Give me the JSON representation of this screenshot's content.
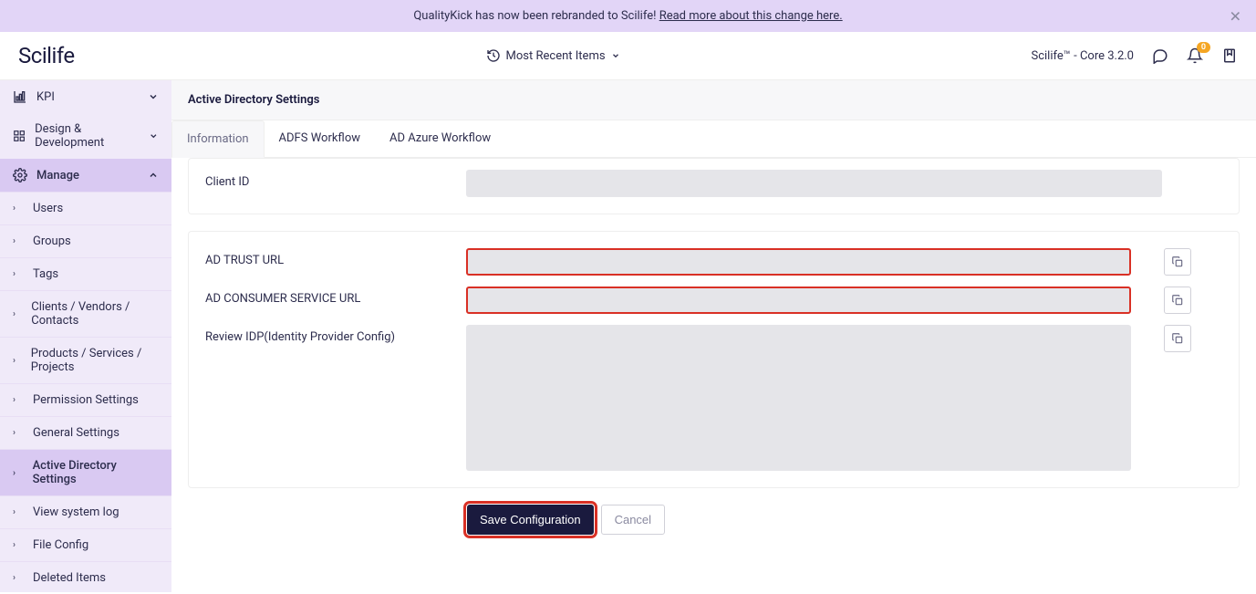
{
  "banner": {
    "text_pre": "QualityKick has now been rebranded to Scilife! ",
    "link_text": "Read more about this change here."
  },
  "header": {
    "logo": "Scilife",
    "recent_items": "Most Recent Items",
    "version": "Scilife™ - Core 3.2.0",
    "notif_badge": "0"
  },
  "sidebar": {
    "top": [
      {
        "label": "KPI",
        "icon": "chart"
      },
      {
        "label": "Design & Development",
        "icon": "grid"
      },
      {
        "label": "Manage",
        "icon": "gear",
        "active": true,
        "open": true
      }
    ],
    "sub": [
      {
        "label": "Users"
      },
      {
        "label": "Groups"
      },
      {
        "label": "Tags"
      },
      {
        "label": "Clients / Vendors / Contacts"
      },
      {
        "label": "Products / Services / Projects"
      },
      {
        "label": "Permission Settings"
      },
      {
        "label": "General Settings"
      },
      {
        "label": "Active Directory Settings",
        "active": true
      },
      {
        "label": "View system log"
      },
      {
        "label": "File Config"
      },
      {
        "label": "Deleted Items"
      }
    ]
  },
  "page": {
    "title": "Active Directory Settings"
  },
  "tabs": [
    {
      "label": "Information",
      "active": true
    },
    {
      "label": "ADFS Workflow"
    },
    {
      "label": "AD Azure Workflow"
    }
  ],
  "fields": {
    "client_id_label": "Client ID",
    "client_id_value": "",
    "ad_trust_label": "AD TRUST URL",
    "ad_trust_value": "",
    "ad_consumer_label": "AD CONSUMER SERVICE URL",
    "ad_consumer_value": "",
    "review_idp_label": "Review IDP(Identity Provider Config)",
    "review_idp_value": ""
  },
  "actions": {
    "save": "Save Configuration",
    "cancel": "Cancel"
  }
}
